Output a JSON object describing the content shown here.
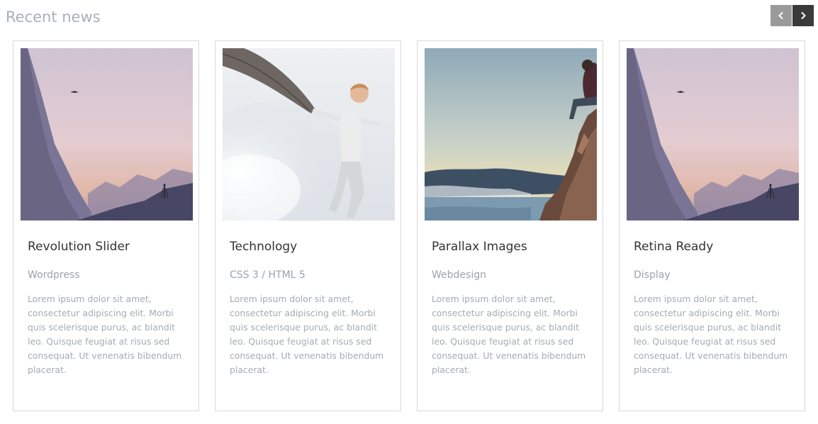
{
  "section": {
    "title": "Recent news"
  },
  "carousel_nav": {
    "prev_icon": "chevron-left-icon",
    "next_icon": "chevron-right-icon",
    "prev_color": "#9a9a9a",
    "next_color": "#3a3a3a"
  },
  "cards": [
    {
      "title": "Revolution Slider",
      "category": "Wordpress",
      "excerpt": "Lorem ipsum dolor sit amet, consectetur adipiscing elit. Morbi quis scelerisque purus, ac blandit leo. Quisque feugiat at risus sed consequat. Ut venenatis bibendum placerat.",
      "image": "mountain-photographer-image"
    },
    {
      "title": "Technology",
      "category": "CSS 3 / HTML 5",
      "excerpt": "Lorem ipsum dolor sit amet, consectetur adipiscing elit. Morbi quis scelerisque purus, ac blandit leo. Quisque feugiat at risus sed consequat. Ut venenatis bibendum placerat.",
      "image": "boy-with-feather-image"
    },
    {
      "title": "Parallax Images",
      "category": "Webdesign",
      "excerpt": "Lorem ipsum dolor sit amet, consectetur adipiscing elit. Morbi quis scelerisque purus, ac blandit leo. Quisque feugiat at risus sed consequat. Ut venenatis bibendum placerat.",
      "image": "cliff-lake-image"
    },
    {
      "title": "Retina Ready",
      "category": "Display",
      "excerpt": "Lorem ipsum dolor sit amet, consectetur adipiscing elit. Morbi quis scelerisque purus, ac blandit leo. Quisque feugiat at risus sed consequat. Ut venenatis bibendum placerat.",
      "image": "mountain-photographer-image"
    }
  ]
}
